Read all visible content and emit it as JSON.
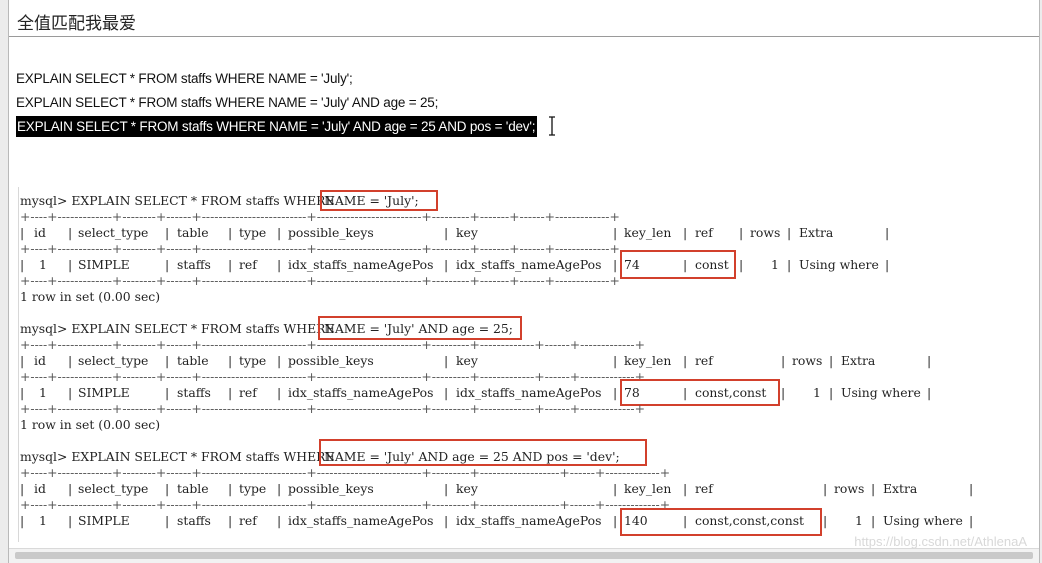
{
  "title": "全值匹配我最爱",
  "sql_lines": [
    "EXPLAIN SELECT * FROM staffs WHERE NAME = 'July';",
    "EXPLAIN SELECT * FROM staffs WHERE NAME = 'July' AND age = 25;",
    "EXPLAIN SELECT * FROM staffs WHERE NAME = 'July' AND age = 25 AND pos = 'dev';"
  ],
  "cursor_icon": "text-cursor-icon",
  "console": {
    "blocks": [
      {
        "prompt": "mysql> EXPLAIN SELECT * FROM staffs WHERE ",
        "condition": "NAME = 'July';",
        "border": "+----+-------------+--------+------+-------------------------+-------------------------+---------+-------+------+-------------+",
        "header": [
          "id",
          "select_type",
          "table",
          "type",
          "possible_keys",
          "key",
          "key_len",
          "ref",
          "rows",
          "Extra"
        ],
        "row": [
          "1",
          "SIMPLE",
          "staffs",
          "ref",
          "idx_staffs_nameAgePos",
          "idx_staffs_nameAgePos",
          "74",
          "const",
          "1",
          "Using where"
        ],
        "footer": "1 row in set (0.00 sec)"
      },
      {
        "prompt": "mysql> EXPLAIN SELECT * FROM staffs WHERE ",
        "condition": "NAME = 'July' AND age = 25;",
        "border": "+----+-------------+--------+------+-------------------------+-------------------------+---------+-------------+------+-------------+",
        "header": [
          "id",
          "select_type",
          "table",
          "type",
          "possible_keys",
          "key",
          "key_len",
          "ref",
          "rows",
          "Extra"
        ],
        "row": [
          "1",
          "SIMPLE",
          "staffs",
          "ref",
          "idx_staffs_nameAgePos",
          "idx_staffs_nameAgePos",
          "78",
          "const,const",
          "1",
          "Using where"
        ],
        "footer": "1 row in set (0.00 sec)"
      },
      {
        "prompt": "mysql> EXPLAIN SELECT * FROM staffs WHERE ",
        "condition": "NAME = 'July' AND age = 25 AND pos = 'dev';",
        "border": "+----+-------------+--------+------+-------------------------+-------------------------+---------+-------------------+------+-------------+",
        "header": [
          "id",
          "select_type",
          "table",
          "type",
          "possible_keys",
          "key",
          "key_len",
          "ref",
          "rows",
          "Extra"
        ],
        "row": [
          "1",
          "SIMPLE",
          "staffs",
          "ref",
          "idx_staffs_nameAgePos",
          "idx_staffs_nameAgePos",
          "140",
          "const,const,const",
          "1",
          "Using where"
        ],
        "footer": ""
      }
    ]
  },
  "watermark": "https://blog.csdn.net/AthlenaA",
  "highlight_color": "#d2402c"
}
